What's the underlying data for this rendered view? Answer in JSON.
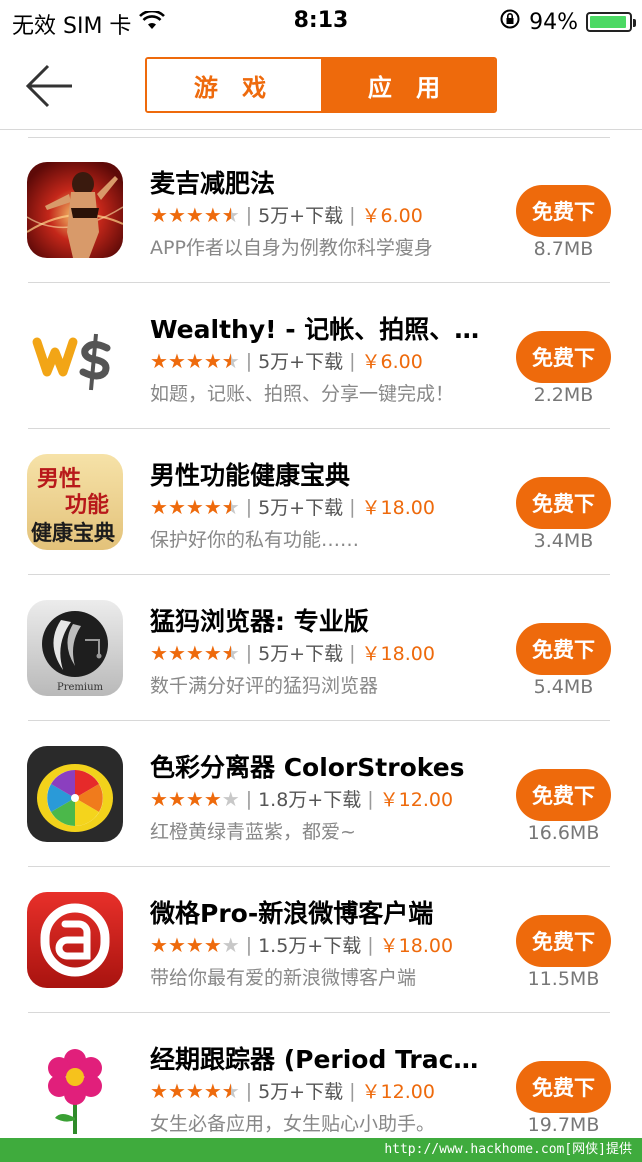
{
  "status_bar": {
    "carrier": "无效 SIM 卡",
    "time": "8:13",
    "battery_percent": "94%",
    "battery_level": 0.94
  },
  "nav": {
    "back_icon": "arrow-left-icon",
    "tabs": [
      {
        "label": "游 戏",
        "active": false
      },
      {
        "label": "应 用",
        "active": true
      }
    ]
  },
  "apps": [
    {
      "name": "麦吉减肥法",
      "rating": 4.5,
      "downloads": "5万+下载",
      "price": "￥6.00",
      "desc": "APP作者以自身为例教你科学瘦身",
      "button": "免费下",
      "size": "8.7MB"
    },
    {
      "name": "Wealthy! - 记帐、拍照、…",
      "rating": 4.5,
      "downloads": "5万+下载",
      "price": "￥6.00",
      "desc": "如题，记账、拍照、分享一键完成！",
      "button": "免费下",
      "size": "2.2MB"
    },
    {
      "name": "男性功能健康宝典",
      "rating": 4.5,
      "downloads": "5万+下载",
      "price": "￥18.00",
      "desc": "保护好你的私有功能……",
      "button": "免费下",
      "size": "3.4MB"
    },
    {
      "name": "猛犸浏览器: 专业版",
      "rating": 4.5,
      "downloads": "5万+下载",
      "price": "￥18.00",
      "desc": "数千满分好评的猛犸浏览器",
      "button": "免费下",
      "size": "5.4MB"
    },
    {
      "name": "色彩分离器 ColorStrokes",
      "rating": 4,
      "downloads": "1.8万+下载",
      "price": "￥12.00",
      "desc": "红橙黄绿青蓝紫，都爱~",
      "button": "免费下",
      "size": "16.6MB"
    },
    {
      "name": "微格Pro-新浪微博客户端",
      "rating": 4,
      "downloads": "1.5万+下载",
      "price": "￥18.00",
      "desc": "带给你最有爱的新浪微博客户端",
      "button": "免费下",
      "size": "11.5MB"
    },
    {
      "name": "经期跟踪器 (Period Trac…",
      "rating": 4.5,
      "downloads": "5万+下载",
      "price": "￥12.00",
      "desc": "女生必备应用，女生贴心小助手。",
      "button": "免费下",
      "size": "19.7MB"
    }
  ],
  "icon_text": {
    "nanxing": [
      "男性",
      "功能",
      "健康宝典"
    ],
    "premium": "Premium"
  },
  "footer": {
    "watermark": "http://www.hackhome.com[网侠]提供"
  },
  "colors": {
    "accent": "#ee6a0c",
    "footer": "#3fab3d",
    "battery": "#4cd964"
  }
}
